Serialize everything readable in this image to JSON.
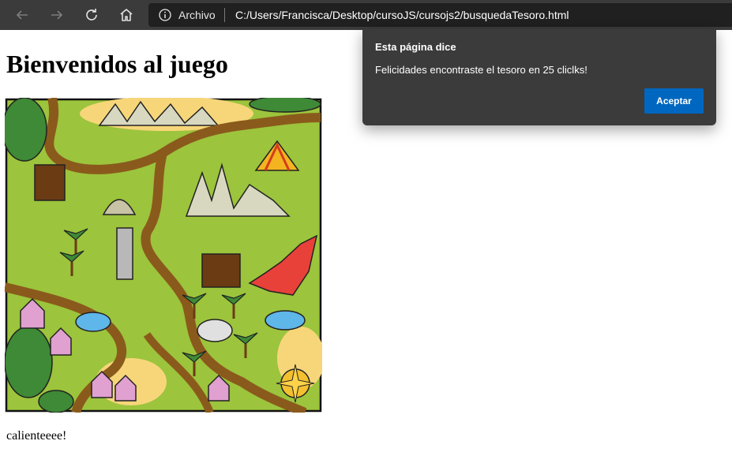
{
  "browser": {
    "site_label": "Archivo",
    "url": "C:/Users/Francisca/Desktop/cursoJS/cursojs2/busquedaTesoro.html",
    "icons": [
      "back-arrow-icon",
      "forward-arrow-icon",
      "refresh-icon",
      "home-icon",
      "info-icon"
    ]
  },
  "page": {
    "heading": "Bienvenidos al juego",
    "status_text": "calienteeee!"
  },
  "dialog": {
    "title": "Esta página dice",
    "message": "Felicidades encontraste el tesoro en 25 cliclks!",
    "accept_label": "Aceptar"
  },
  "colors": {
    "toolbar_bg": "#3b3b3b",
    "address_bg": "#202020",
    "dialog_bg": "#3b3b3b",
    "accent": "#0067c0",
    "map_grass": "#9cc43c"
  }
}
